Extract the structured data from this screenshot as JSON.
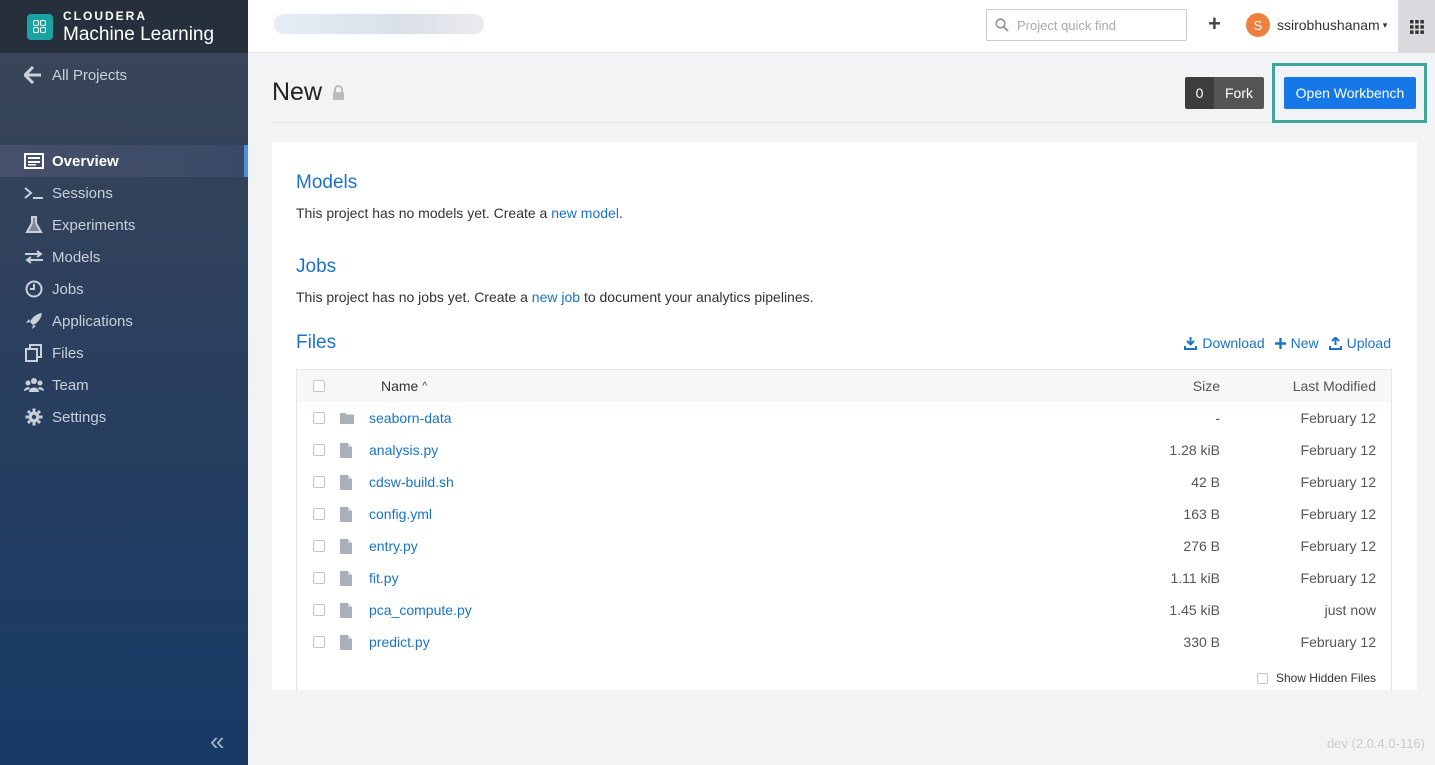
{
  "brand": {
    "company": "CLOUDERA",
    "product": "Machine Learning"
  },
  "sidebar": {
    "back_label": "All Projects",
    "items": [
      {
        "label": "Overview",
        "icon": "overview-icon"
      },
      {
        "label": "Sessions",
        "icon": "terminal-icon"
      },
      {
        "label": "Experiments",
        "icon": "flask-icon"
      },
      {
        "label": "Models",
        "icon": "arrows-icon"
      },
      {
        "label": "Jobs",
        "icon": "clock-icon"
      },
      {
        "label": "Applications",
        "icon": "rocket-icon"
      },
      {
        "label": "Files",
        "icon": "files-icon"
      },
      {
        "label": "Team",
        "icon": "team-icon"
      },
      {
        "label": "Settings",
        "icon": "gear-icon"
      }
    ],
    "collapse_glyph": "«"
  },
  "topbar": {
    "search_placeholder": "Project quick find",
    "plus": "+",
    "user_initial": "S",
    "username": "ssirobhushanam",
    "caret": "▾"
  },
  "page": {
    "title": "New",
    "fork_count": "0",
    "fork_label": "Fork",
    "workbench_label": "Open Workbench"
  },
  "models": {
    "heading": "Models",
    "text_before": "This project has no models yet. Create a ",
    "link": "new model",
    "text_after": "."
  },
  "jobs": {
    "heading": "Jobs",
    "text_before": "This project has no jobs yet. Create a ",
    "link": "new job",
    "text_after": " to document your analytics pipelines."
  },
  "files": {
    "heading": "Files",
    "actions": {
      "download": "Download",
      "new": "New",
      "upload": "Upload"
    },
    "columns": {
      "name": "Name",
      "sort": "^",
      "size": "Size",
      "modified": "Last Modified"
    },
    "rows": [
      {
        "name": "seaborn-data",
        "type": "folder",
        "size": "-",
        "modified": "February 12"
      },
      {
        "name": "analysis.py",
        "type": "file",
        "size": "1.28 kiB",
        "modified": "February 12"
      },
      {
        "name": "cdsw-build.sh",
        "type": "file",
        "size": "42 B",
        "modified": "February 12"
      },
      {
        "name": "config.yml",
        "type": "file",
        "size": "163 B",
        "modified": "February 12"
      },
      {
        "name": "entry.py",
        "type": "file",
        "size": "276 B",
        "modified": "February 12"
      },
      {
        "name": "fit.py",
        "type": "file",
        "size": "1.11 kiB",
        "modified": "February 12"
      },
      {
        "name": "pca_compute.py",
        "type": "file",
        "size": "1.45 kiB",
        "modified": "just now"
      },
      {
        "name": "predict.py",
        "type": "file",
        "size": "330 B",
        "modified": "February 12"
      }
    ],
    "show_hidden_label": "Show Hidden Files"
  },
  "version": "dev (2.0.4.0-116)",
  "colors": {
    "accent": "#1577e8",
    "link": "#1a73c9",
    "highlight_frame": "#3fa69b",
    "avatar": "#ee7f3f"
  }
}
